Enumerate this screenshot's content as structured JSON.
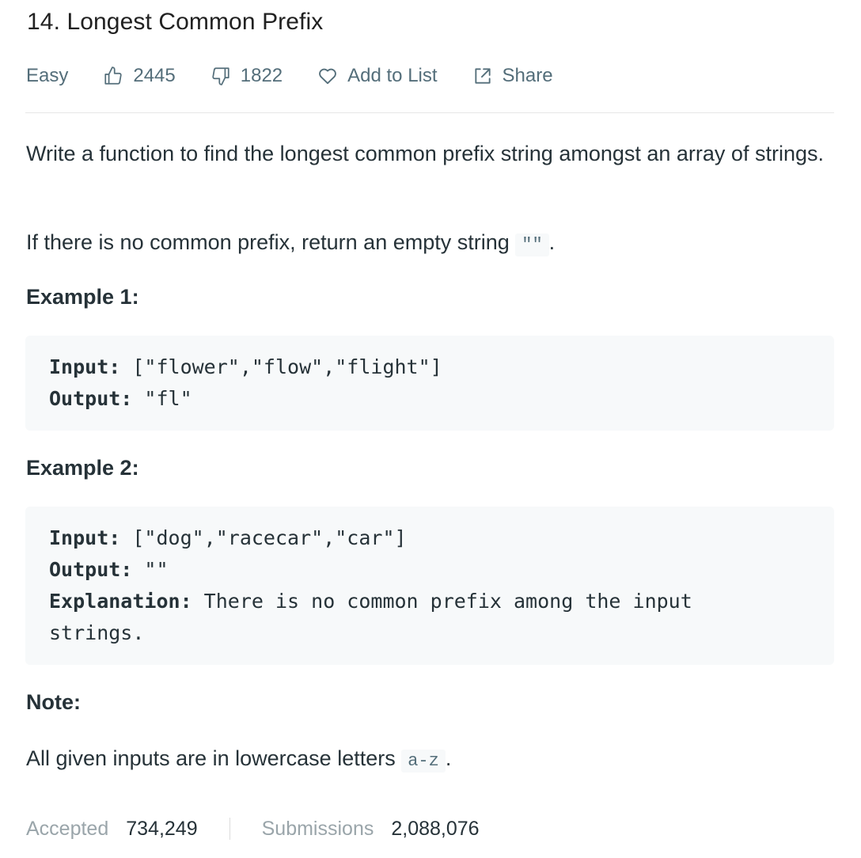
{
  "problem": {
    "title": "14. Longest Common Prefix",
    "difficulty": "Easy",
    "likes": "2445",
    "dislikes": "1822",
    "add_to_list": "Add to List",
    "share": "Share"
  },
  "description": {
    "para1": "Write a function to find the longest common prefix string amongst an array of strings.",
    "para2_text": "If there is no common prefix, return an empty string ",
    "para2_code": "\"\"",
    "para2_end": "."
  },
  "example1": {
    "heading": "Example 1:",
    "input_label": "Input:",
    "input_value": " [\"flower\",\"flow\",\"flight\"]",
    "output_label": "Output:",
    "output_value": " \"fl\""
  },
  "example2": {
    "heading": "Example 2:",
    "input_label": "Input:",
    "input_value": " [\"dog\",\"racecar\",\"car\"]",
    "output_label": "Output:",
    "output_value": " \"\"",
    "explanation_label": "Explanation:",
    "explanation_value": " There is no common prefix among the input",
    "explanation_cont": "strings."
  },
  "note": {
    "heading": "Note:",
    "text": "All given inputs are in lowercase letters ",
    "code": "a-z",
    "end": "."
  },
  "stats": {
    "accepted_label": "Accepted",
    "accepted_value": "734,249",
    "submissions_label": "Submissions",
    "submissions_value": "2,088,076"
  },
  "icons": {
    "like": "thumbs-up-icon",
    "dislike": "thumbs-down-icon",
    "favorite": "heart-icon",
    "share": "share-icon"
  }
}
